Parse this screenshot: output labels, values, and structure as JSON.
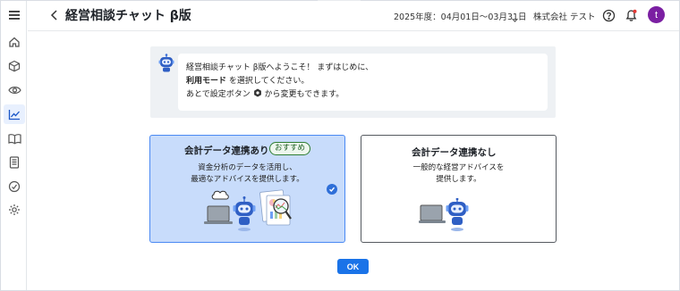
{
  "header": {
    "title": "経営相談チャット β版",
    "fiscal_period": "2025年度：04月01日〜03月31日",
    "company": "株式会社 テスト",
    "avatar_initial": "t"
  },
  "sidebar": {
    "items": [
      {
        "icon": "menu-icon"
      },
      {
        "icon": "home-icon"
      },
      {
        "icon": "box-icon"
      },
      {
        "icon": "eye-icon"
      },
      {
        "icon": "chart-icon",
        "active": true
      },
      {
        "icon": "book-icon"
      },
      {
        "icon": "document-icon"
      },
      {
        "icon": "badge-icon"
      },
      {
        "icon": "settings-icon"
      }
    ]
  },
  "chat": {
    "line1": "経営相談チャット β版へようこそ！ まずはじめに、",
    "line2_bold": "利用モード",
    "line2_rest": " を選択してください。",
    "line3_a": "あとで設定ボタン ",
    "line3_b": " から変更もできます。"
  },
  "options": [
    {
      "title": "会計データ連携あり",
      "badge": "おすすめ",
      "desc1": "資金分析のデータを活用し、",
      "desc2": "最適なアドバイスを提供します。",
      "selected": true
    },
    {
      "title": "会計データ連携なし",
      "desc1": "一般的な経営アドバイスを",
      "desc2": "提供します。",
      "selected": false
    }
  ],
  "ok_label": "OK",
  "colors": {
    "accent": "#1a73e8",
    "selected_card": "#c8dcfb",
    "badge_green": "#2e7d32",
    "avatar": "#7b1fa2",
    "notification": "#e53935"
  }
}
